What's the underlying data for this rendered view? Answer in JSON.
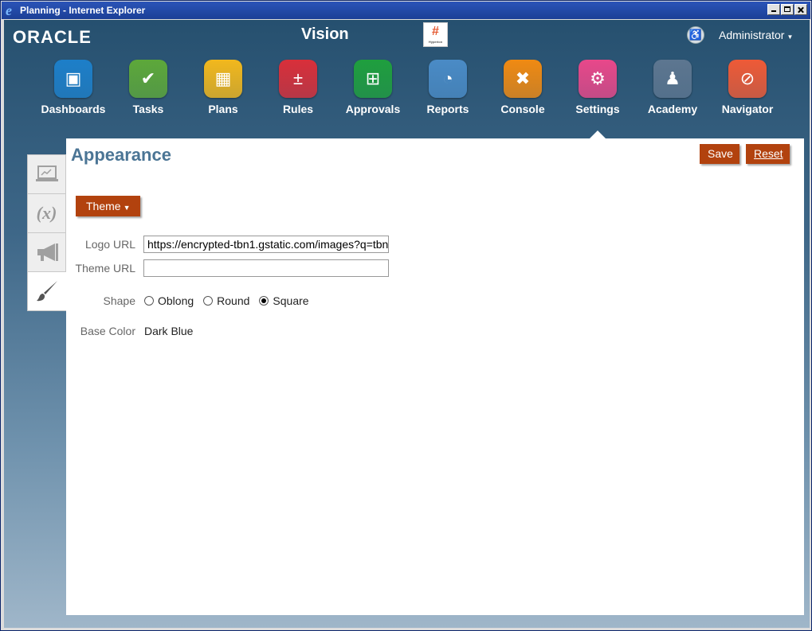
{
  "window": {
    "title": "Planning - Internet Explorer"
  },
  "header": {
    "brand": "ORACLE",
    "app_title": "Vision",
    "logo_mark": "#",
    "logo_caption": "Hyperion",
    "user": "Administrator"
  },
  "nav": [
    {
      "label": "Dashboards",
      "color": "#1d7fc9",
      "glyph": "▣"
    },
    {
      "label": "Tasks",
      "color": "#5da83a",
      "glyph": "✔"
    },
    {
      "label": "Plans",
      "color": "#f2b81d",
      "glyph": "▦"
    },
    {
      "label": "Rules",
      "color": "#d92f3a",
      "glyph": "±"
    },
    {
      "label": "Approvals",
      "color": "#1f9f3e",
      "glyph": "⊞"
    },
    {
      "label": "Reports",
      "color": "#4a8bc6",
      "glyph": "◔"
    },
    {
      "label": "Console",
      "color": "#f08a12",
      "glyph": "✖"
    },
    {
      "label": "Settings",
      "color": "#e8488a",
      "glyph": "⚙"
    },
    {
      "label": "Academy",
      "color": "#5d7690",
      "glyph": "♟"
    },
    {
      "label": "Navigator",
      "color": "#ee5a37",
      "glyph": "⊘"
    }
  ],
  "page": {
    "title": "Appearance",
    "save_label": "Save",
    "reset_label": "Reset",
    "theme_label": "Theme",
    "logo_url_label": "Logo URL",
    "logo_url_value": "https://encrypted-tbn1.gstatic.com/images?q=tbn",
    "theme_url_label": "Theme URL",
    "theme_url_value": "",
    "shape_label": "Shape",
    "shape_options": [
      "Oblong",
      "Round",
      "Square"
    ],
    "shape_selected": "Square",
    "base_color_label": "Base Color",
    "base_color_value": "Dark Blue"
  }
}
